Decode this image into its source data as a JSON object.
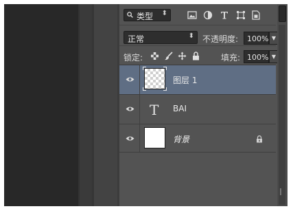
{
  "filter": {
    "kind_label": "类型",
    "icons": [
      "pixel-filter-icon",
      "adjustment-filter-icon",
      "type-filter-icon",
      "shape-filter-icon",
      "smart-object-filter-icon"
    ]
  },
  "blend": {
    "mode": "正常",
    "opacity_label": "不透明度:",
    "opacity_value": "100%"
  },
  "lockrow": {
    "label": "锁定:",
    "fill_label": "填充:",
    "fill_value": "100%"
  },
  "layers": [
    {
      "name": "图层 1",
      "type": "pixel",
      "selected": true,
      "visible": true
    },
    {
      "name": "BAI",
      "type": "text",
      "selected": false,
      "visible": true
    },
    {
      "name": "背景",
      "type": "background",
      "selected": false,
      "visible": true,
      "locked": true
    }
  ],
  "colors": {
    "panel": "#535353",
    "selected": "#5f6e84",
    "field": "#2e2e2e"
  }
}
